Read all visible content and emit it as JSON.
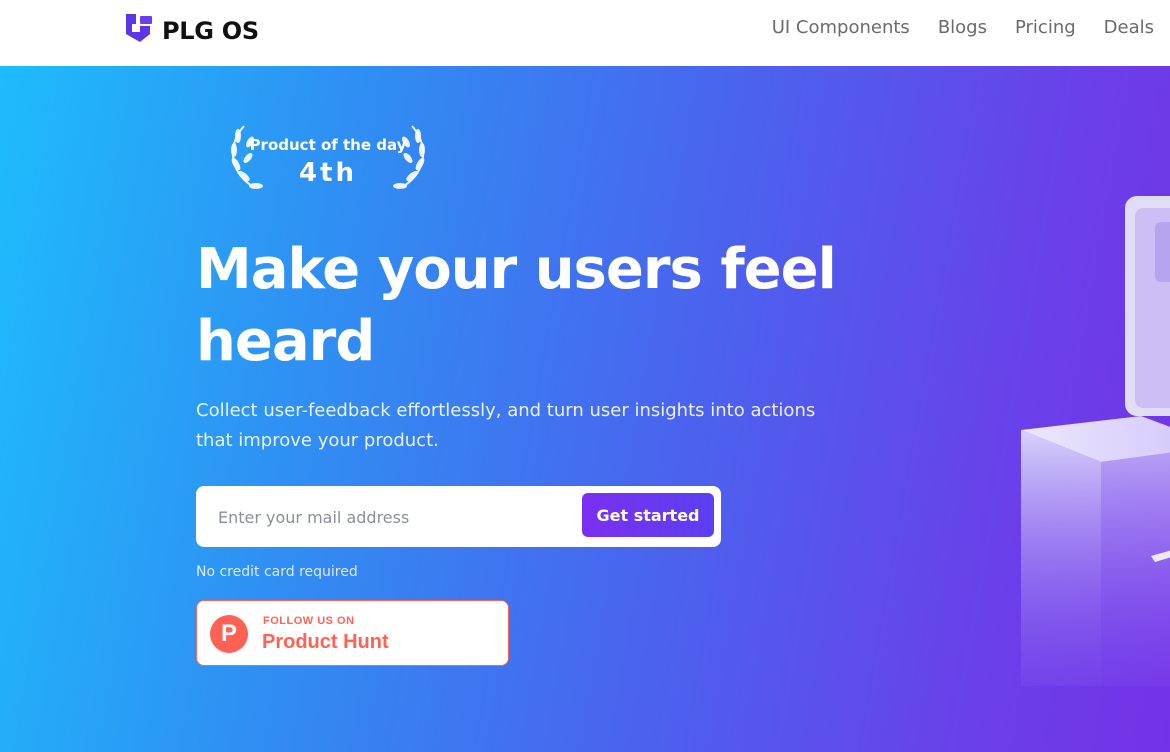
{
  "nav": {
    "brand": "PLG OS",
    "links": [
      "UI Components",
      "Blogs",
      "Pricing",
      "Deals"
    ]
  },
  "hero": {
    "award": {
      "title": "Product of the day",
      "rank": "4th"
    },
    "headline_line1": "Make your users feel",
    "headline_line2": "heard",
    "subtext_line1": "Collect user-feedback effortlessly, and turn user insights into actions",
    "subtext_line2": "that improve your product.",
    "email_placeholder": "Enter your mail address",
    "cta_label": "Get started",
    "note": "No credit card required",
    "product_hunt": {
      "small": "FOLLOW US ON",
      "big": "Product Hunt",
      "letter": "P"
    }
  },
  "colors": {
    "gradient_start": "#1ebcfb",
    "gradient_end": "#7432e8",
    "brand_purple": "#6b3ef0",
    "product_hunt": "#ff6154"
  }
}
